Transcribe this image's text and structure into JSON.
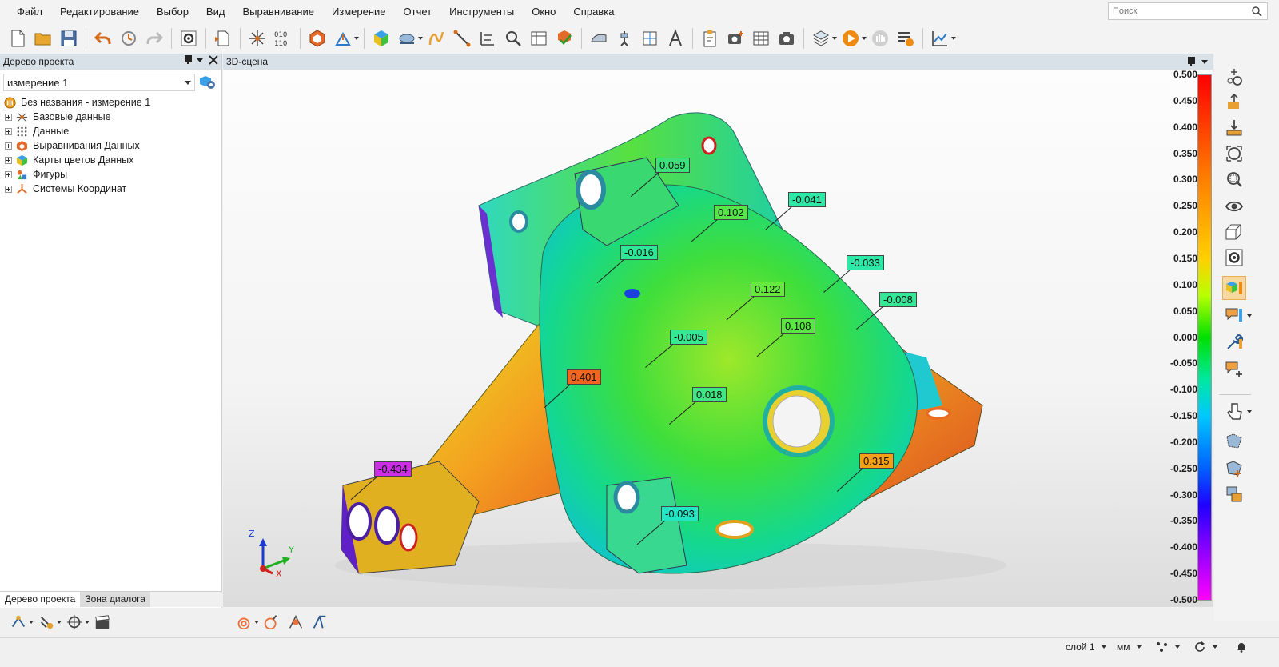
{
  "menu": [
    "Файл",
    "Редактирование",
    "Выбор",
    "Вид",
    "Выравнивание",
    "Измерение",
    "Отчет",
    "Инструменты",
    "Окно",
    "Справка"
  ],
  "search": {
    "placeholder": "Поиск"
  },
  "left_panel": {
    "title": "Дерево проекта",
    "measurement_select": "измерение 1",
    "tree_root": "Без названия - измерение 1",
    "tree_items": [
      "Базовые данные",
      "Данные",
      "Выравнивания Данных",
      "Карты цветов Данных",
      "Фигуры",
      "Системы Координат"
    ],
    "tabs": [
      "Дерево проекта",
      "Зона диалога"
    ]
  },
  "scene": {
    "title": "3D-сцена",
    "axes": {
      "z": "Z",
      "y": "Y",
      "x": "X"
    },
    "callouts": [
      {
        "value": "0.059",
        "color": "#3de07a"
      },
      {
        "value": "0.102",
        "color": "#56e64a"
      },
      {
        "value": "-0.041",
        "color": "#2ee8a6"
      },
      {
        "value": "-0.016",
        "color": "#2ee89a"
      },
      {
        "value": "-0.033",
        "color": "#2ee8a6"
      },
      {
        "value": "0.122",
        "color": "#66ea3e"
      },
      {
        "value": "-0.008",
        "color": "#34e898"
      },
      {
        "value": "0.108",
        "color": "#5ce646"
      },
      {
        "value": "-0.005",
        "color": "#36e894"
      },
      {
        "value": "0.401",
        "color": "#f2651e"
      },
      {
        "value": "0.018",
        "color": "#40e684"
      },
      {
        "value": "-0.434",
        "color": "#cc2ee6"
      },
      {
        "value": "0.315",
        "color": "#f6a014"
      },
      {
        "value": "-0.093",
        "color": "#22e6c4"
      }
    ]
  },
  "color_scale": {
    "labels": [
      "0.500",
      "0.450",
      "0.400",
      "0.350",
      "0.300",
      "0.250",
      "0.200",
      "0.150",
      "0.100",
      "0.050",
      "0.000",
      "-0.050",
      "-0.100",
      "-0.150",
      "-0.200",
      "-0.250",
      "-0.300",
      "-0.350",
      "-0.400",
      "-0.450",
      "-0.500"
    ]
  },
  "status": {
    "layer": "слой 1",
    "units": "мм"
  }
}
